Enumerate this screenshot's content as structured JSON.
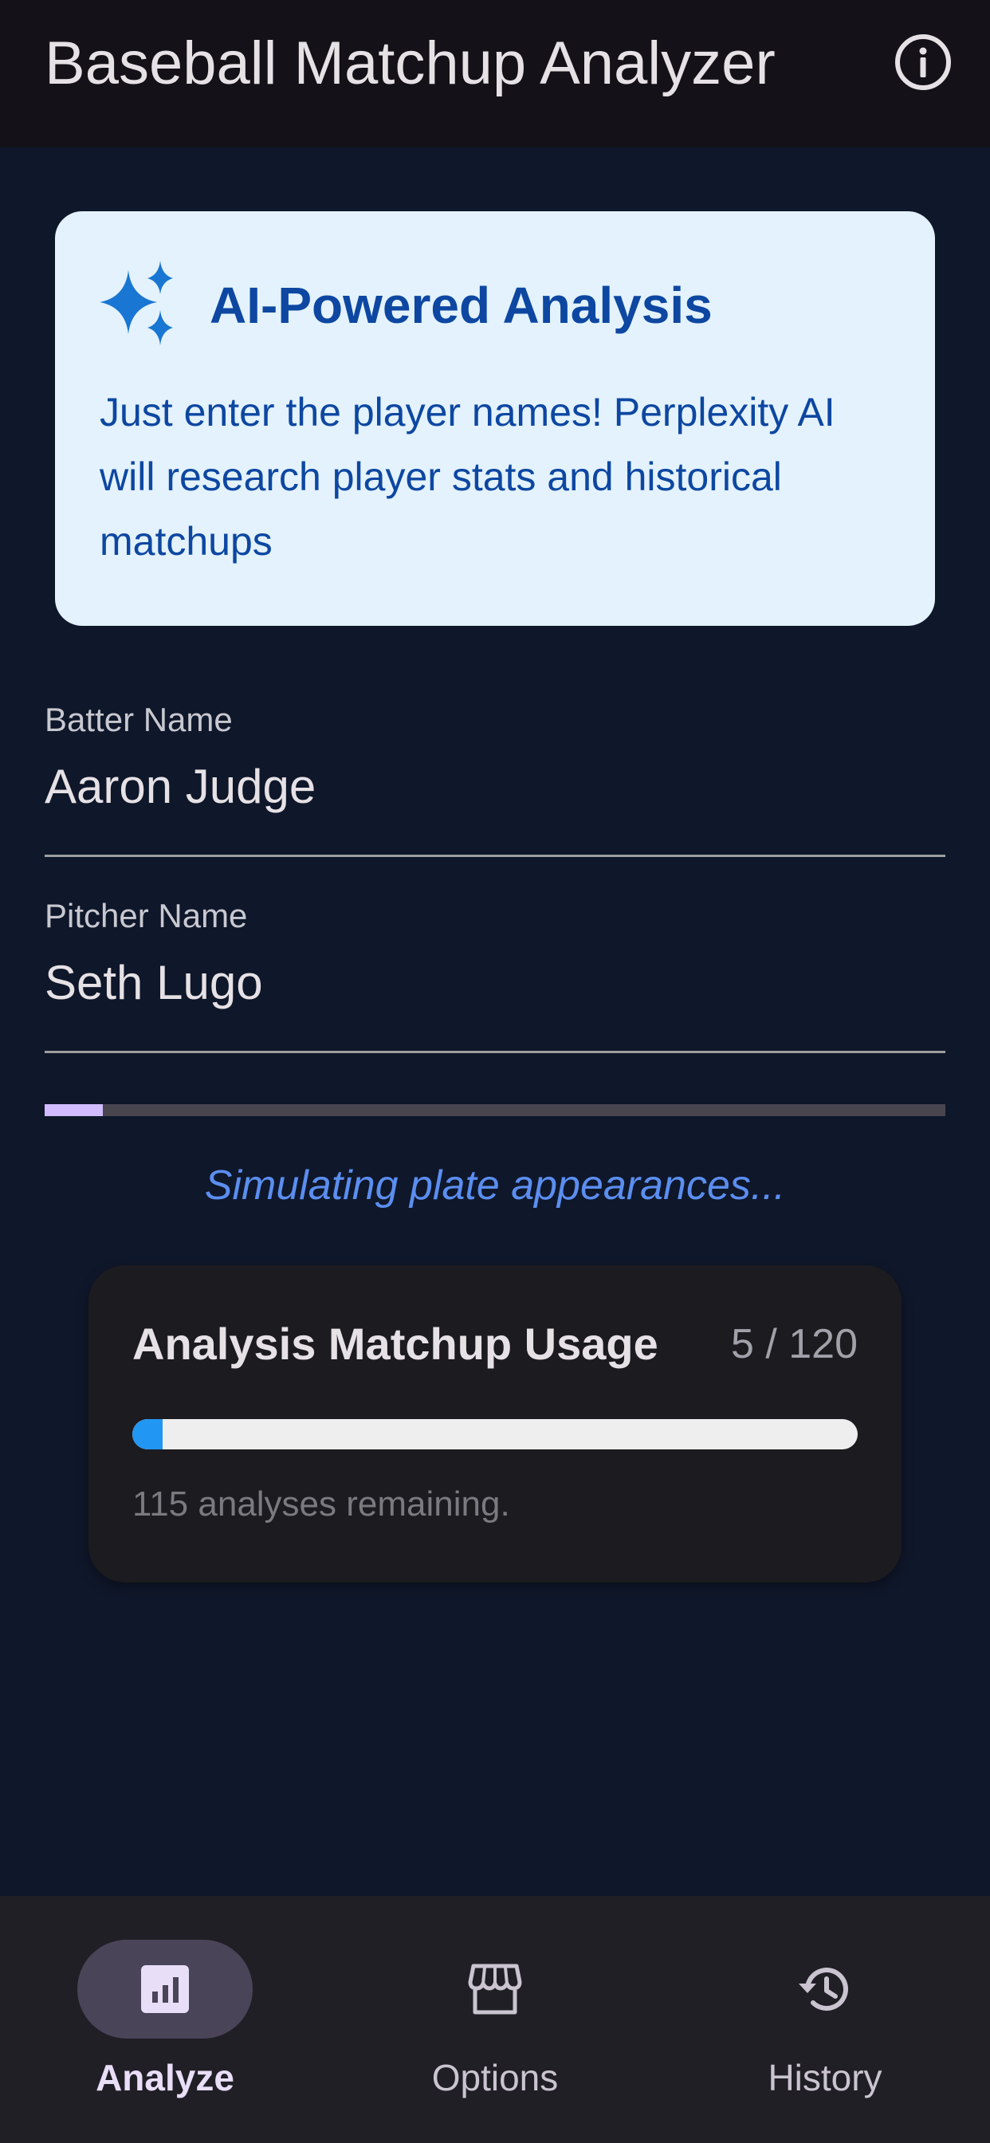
{
  "app_bar": {
    "title": "Baseball Matchup Analyzer",
    "info_icon": "info-circle-icon"
  },
  "info_card": {
    "icon": "sparkle-icon",
    "heading": "AI-Powered Analysis",
    "body": "Just enter the player names! Perplexity AI will research player stats and historical matchups",
    "background": "#e3f2fd",
    "text_color": "#0d47a1"
  },
  "form": {
    "batter": {
      "label": "Batter Name",
      "value": "Aaron Judge"
    },
    "pitcher": {
      "label": "Pitcher Name",
      "value": "Seth Lugo"
    }
  },
  "simulation": {
    "progress": 0.065,
    "status": "Simulating plate appearances...",
    "progress_color": "#d0bcff",
    "status_color": "#5b8ef0"
  },
  "usage": {
    "title": "Analysis Matchup Usage",
    "count": "5 / 120",
    "used": 5,
    "limit": 120,
    "remaining": "115 analyses remaining.",
    "bar_color": "#2196f3"
  },
  "bottom_nav": {
    "items": [
      {
        "label": "Analyze",
        "icon": "bar-chart-icon",
        "active": true
      },
      {
        "label": "Options",
        "icon": "storefront-icon",
        "active": false
      },
      {
        "label": "History",
        "icon": "history-icon",
        "active": false
      }
    ]
  },
  "colors": {
    "background": "#0f172a",
    "app_bar": "#141218",
    "nav_background": "#211f26",
    "active_pill": "#4a4458"
  }
}
